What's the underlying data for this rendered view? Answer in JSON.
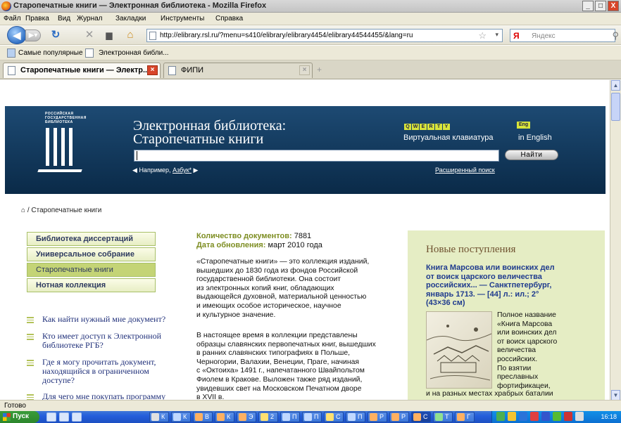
{
  "window": {
    "title": "Старопечатные книги — Электронная библиотека - Mozilla Firefox",
    "controls": [
      "_",
      "□",
      "X"
    ]
  },
  "menu": [
    "Файл",
    "Правка",
    "Вид",
    "Журнал",
    "Закладки",
    "Инструменты",
    "Справка"
  ],
  "nav": {
    "url": "http://elibrary.rsl.ru/?menu=s410/elibrary/elibrary4454/elibrary44544455/&lang=ru",
    "search_brand": "Я",
    "search_placeholder": "Яндекс"
  },
  "bookmarks": [
    "Самые популярные",
    "Электронная библи..."
  ],
  "tabs": [
    {
      "label": "Старопечатные книги — Электр...",
      "active": true
    },
    {
      "label": "ФИПИ",
      "active": false
    }
  ],
  "banner": {
    "logo_text": [
      "РОССИЙСКАЯ",
      "ГОСУДАРСТВЕННАЯ",
      "БИБЛИОТЕКА"
    ],
    "title_line1": "Электронная библиотека:",
    "title_line2": "Старопечатные книги",
    "keyboard_keys": [
      "Q",
      "W",
      "E",
      "R",
      "T",
      "Y"
    ],
    "keyboard_label": "Виртуальная клавиатура",
    "eng_badge": "Eng",
    "eng_label": "in English",
    "search_value": "",
    "find_button": "Найти",
    "example_prefix": "Например,",
    "example_link": "Азбук",
    "example_suffix": "*",
    "advanced_search": "Расширенный поиск"
  },
  "breadcrumb": {
    "home_icon": "home-icon",
    "text": "/ Старопечатные книги"
  },
  "left_nav": [
    {
      "label": "Библиотека диссертаций",
      "selected": false
    },
    {
      "label": "Универсальное собрание",
      "selected": false
    },
    {
      "label": "Старопечатные книги",
      "selected": true
    },
    {
      "label": "Нотная коллекция",
      "selected": false
    }
  ],
  "questions": [
    {
      "lines": [
        "Как найти нужный мне документ?"
      ]
    },
    {
      "lines": [
        "Кто имеет доступ к Электронной",
        "библиотеке РГБ?"
      ]
    },
    {
      "lines": [
        "Где я могу прочитать документ,",
        "находящийся в ограниченном",
        "доступе?"
      ]
    },
    {
      "lines": [
        "Для чего мне покупать программу"
      ]
    }
  ],
  "meta": {
    "count_label": "Количество документов:",
    "count_value": "7881",
    "date_label": "Дата обновления:",
    "date_value": "март 2010 года"
  },
  "description_p1": [
    "«Старопечатные книги» — это коллекция изданий,",
    "вышедших до 1830 года из фондов Российской",
    "государственной библиотеки. Она состоит",
    "из электронных копий книг, обладающих",
    "выдающейся духовной, материальной ценностью",
    "и имеющих особое историческое, научное",
    "и культурное значение."
  ],
  "description_p2": [
    "В настоящее время в коллекции представлены",
    "образцы славянских первопечатных книг, вышедших",
    "в ранних славянских типографиях в Польше,",
    "Черногории, Валахии, Венеции, Праге, начиная",
    "с «Октоиха» 1491 г., напечатанного Швайпольтом",
    "Фиолем в Кракове. Выложен также ряд изданий,",
    "увидевших свет на Московском Печатном дворе",
    "в XVII в."
  ],
  "new_arrivals": {
    "heading": "Новые поступления",
    "book_title": [
      "Книга Марсова или воинских дел",
      "от воиск царского величества",
      "российских... — Санктпетербург,",
      "январь 1713. — [44] л.: ил.; 2°",
      "(43×36 см)"
    ],
    "desc": [
      "Полное название",
      "«Книга Марсова",
      "или воинских дел",
      "от воиск царского",
      "величества",
      "российских.",
      "По взятии",
      "преславных",
      "фортификацеи,"
    ],
    "desc_tail": "и на разных местах храбрых баталии"
  },
  "status": "Готово",
  "taskbar": {
    "start": "Пуск",
    "buttons": [
      {
        "label": "К",
        "color": "#e0e0e0"
      },
      {
        "label": "К",
        "color": "#c0d8ff"
      },
      {
        "label": "В",
        "color": "#ffb060"
      },
      {
        "label": "К",
        "color": "#ffb060"
      },
      {
        "label": "Э",
        "color": "#ffb060"
      },
      {
        "label": "2",
        "color": "#ffe070"
      },
      {
        "label": "П",
        "color": "#c0d8ff"
      },
      {
        "label": "П",
        "color": "#c0d8ff"
      },
      {
        "label": "С",
        "color": "#ffe070"
      },
      {
        "label": "П",
        "color": "#c0d8ff"
      },
      {
        "label": "Р",
        "color": "#ffb060"
      },
      {
        "label": "Р",
        "color": "#ffb060"
      },
      {
        "label": "С",
        "color": "#ffb060"
      },
      {
        "label": "Т",
        "color": "#90e090"
      },
      {
        "label": "Г",
        "color": "#ffb060"
      }
    ],
    "clock": "16:18"
  }
}
